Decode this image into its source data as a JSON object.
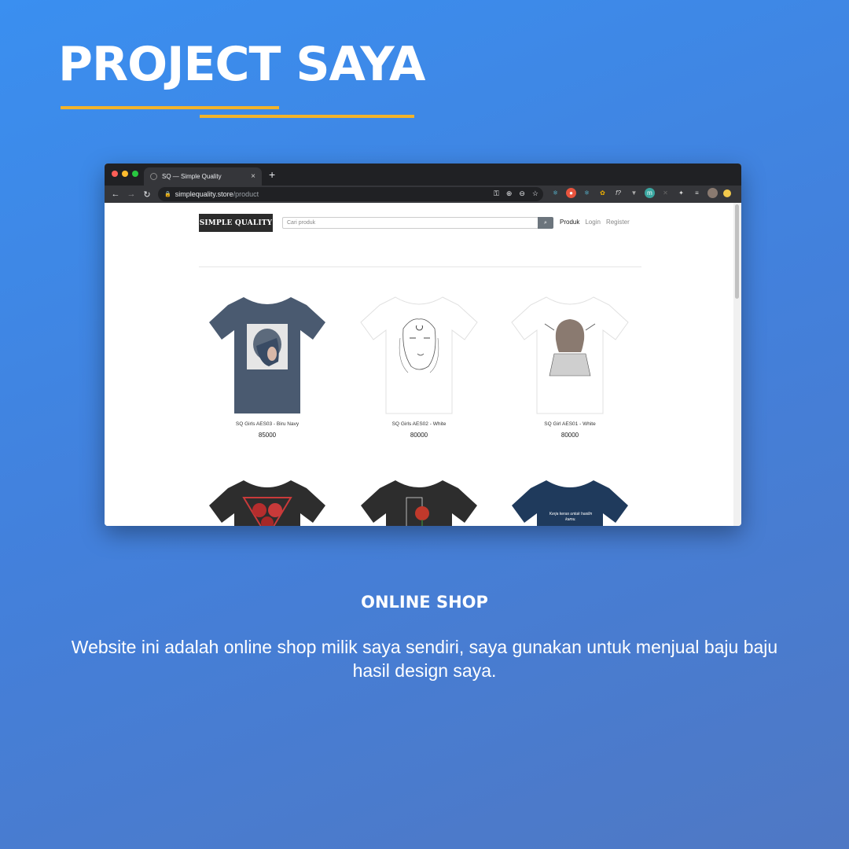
{
  "heading": "PROJECT SAYA",
  "colors": {
    "accent": "#f2b32a",
    "background": "#3a8ff0"
  },
  "browser": {
    "tab_title": "SQ — Simple Quality",
    "new_tab": "+",
    "tab_close": "×",
    "url_host": "simplequality.store",
    "url_path": "/product"
  },
  "site": {
    "logo": "SIMPLE QUALITY",
    "search_placeholder": "Cari produk",
    "search_icon": "🔍",
    "nav": {
      "produk": "Produk",
      "login": "Login",
      "register": "Register"
    },
    "products": [
      {
        "name": "SQ Girls AES03 - Biru Navy",
        "price": "85000",
        "shirt_color": "#4a5a70"
      },
      {
        "name": "SQ Girls AES02 - White",
        "price": "80000",
        "shirt_color": "#ffffff"
      },
      {
        "name": "SQ Girl AES01 - White",
        "price": "80000",
        "shirt_color": "#ffffff"
      }
    ],
    "more_products_text": "Kerja keras untuk hasilin kamu."
  },
  "section_title": "ONLINE SHOP",
  "description": "Website ini adalah online shop milik saya sendiri, saya gunakan untuk menjual baju baju hasil design saya."
}
